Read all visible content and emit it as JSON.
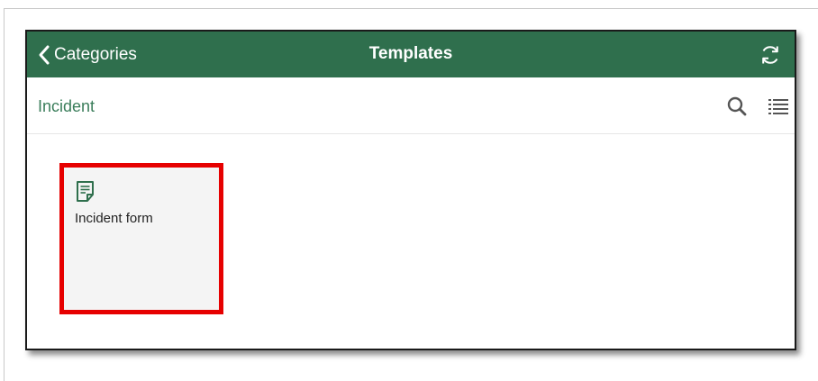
{
  "nav": {
    "back_label": "Categories",
    "title": "Templates",
    "back_icon": "chevron-left-icon",
    "refresh_icon": "refresh-icon"
  },
  "toolbar": {
    "category": "Incident",
    "search_icon": "search-icon",
    "list_icon": "list-view-icon"
  },
  "templates": [
    {
      "title": "Incident form",
      "icon": "form-document-icon",
      "highlighted": true
    }
  ],
  "colors": {
    "header_bg": "#2f6f4d",
    "accent_text": "#3a7d5a",
    "highlight_border": "#e60000",
    "card_bg": "#f4f4f4"
  }
}
